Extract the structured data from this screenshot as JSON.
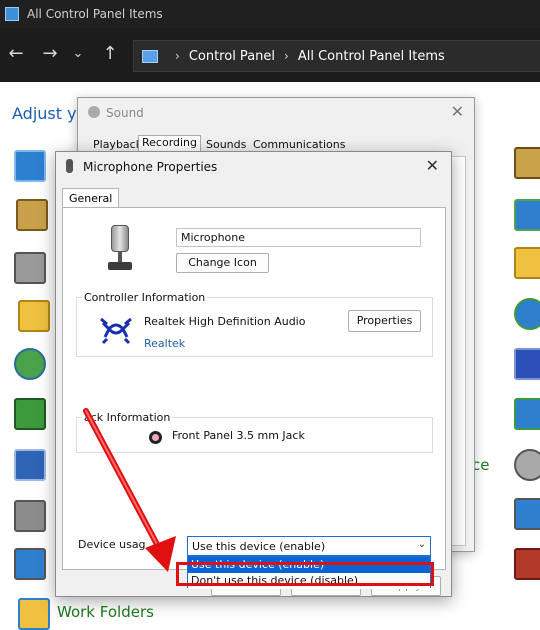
{
  "explorer": {
    "window_title": "All Control Panel Items",
    "breadcrumb": [
      "Control Panel",
      "All Control Panel Items"
    ],
    "adjust_text": "Adjust yo",
    "work_folders": "Work Folders",
    "right_fragment": "ce"
  },
  "sound_dialog": {
    "title": "Sound",
    "tabs": [
      "Playback",
      "Recording",
      "Sounds",
      "Communications"
    ],
    "active_tab": "Recording"
  },
  "mic_dialog": {
    "title": "Microphone Properties",
    "tab": "General",
    "device_name": "Microphone",
    "change_icon": "Change Icon",
    "controller_legend": "Controller Information",
    "controller_name": "Realtek High Definition Audio",
    "properties_button": "Properties",
    "controller_link": "Realtek",
    "jack_legend": "ack Information",
    "jack_name": "Front Panel 3.5 mm Jack",
    "device_usage_label": "Device usag",
    "device_usage_value": "Use this device (enable)",
    "options": [
      "Use this device (enable)",
      "Don't use this device (disable)"
    ],
    "ok": "OK",
    "cancel": "Cancel",
    "apply": "Apply"
  },
  "colors": {
    "annotation": "#e01010",
    "selection": "#0a64d6",
    "dark_chrome": "#1c1c1c"
  }
}
